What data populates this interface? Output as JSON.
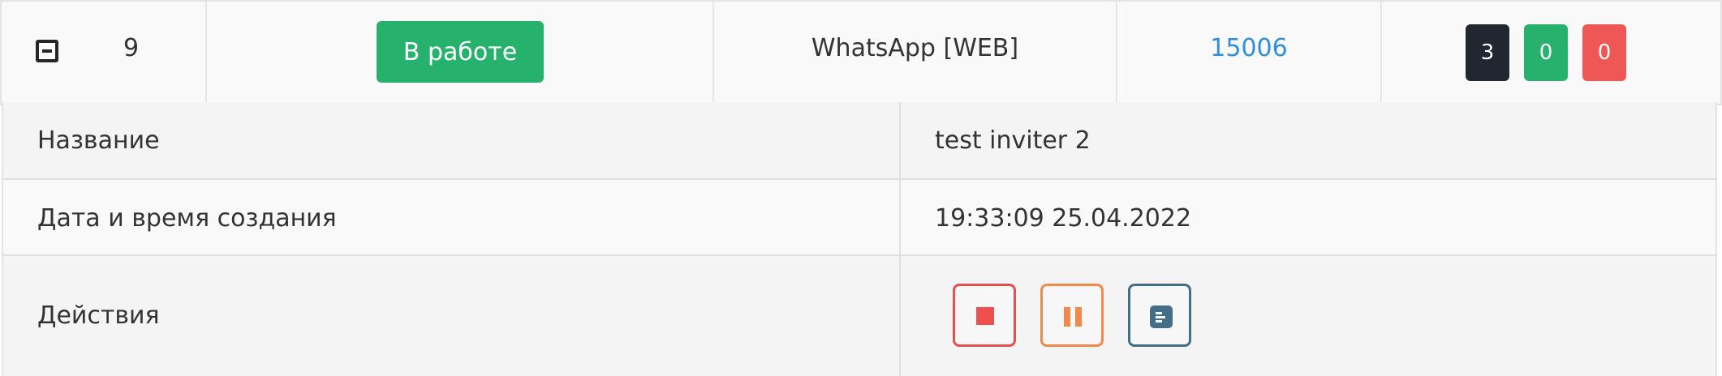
{
  "row": {
    "number": "9",
    "status_label": "В работе",
    "channel": "WhatsApp [WEB]",
    "id_link": "15006",
    "counters": [
      {
        "value": "3",
        "color": "#222631"
      },
      {
        "value": "0",
        "color": "#26b26d"
      },
      {
        "value": "0",
        "color": "#ef5656"
      }
    ]
  },
  "details": {
    "name_label": "Название",
    "name_value": "test inviter 2",
    "created_label": "Дата и время создания",
    "created_value": "19:33:09 25.04.2022",
    "actions_label": "Действия"
  },
  "actions": [
    {
      "name": "stop",
      "icon": "stop-icon",
      "color": "#e35252"
    },
    {
      "name": "pause",
      "icon": "pause-icon",
      "color": "#f0894a"
    },
    {
      "name": "log",
      "icon": "document-icon",
      "color": "#436d88"
    }
  ]
}
